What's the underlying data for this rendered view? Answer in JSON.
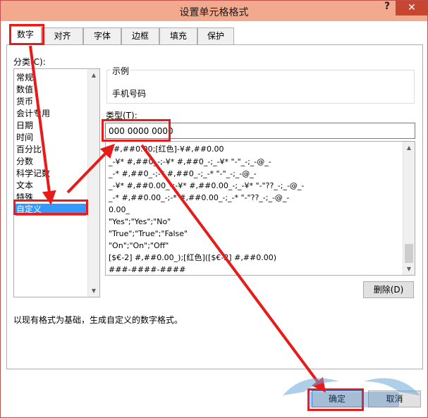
{
  "window": {
    "title": "设置单元格格式",
    "help": "?",
    "close": "✕"
  },
  "tabs": [
    "数字",
    "对齐",
    "字体",
    "边框",
    "填充",
    "保护"
  ],
  "category": {
    "label": "分类(C):",
    "items": [
      "常规",
      "数值",
      "货币",
      "会计专用",
      "日期",
      "时间",
      "百分比",
      "分数",
      "科学记数",
      "文本",
      "特殊",
      "自定义"
    ],
    "selected": "自定义"
  },
  "sample": {
    "label": "示例",
    "value": "手机号码"
  },
  "type": {
    "label": "类型(T):",
    "value": "000 0000 0000",
    "formats": [
      "¥#,##0.00;[红色]-¥#,##0.00",
      "_-¥* #,##0_-;-¥* #,##0_-;_-¥* \"-\"_-;_-@_-",
      "_-* #,##0_-;-* #,##0_-;_-* \"-\"_-;_-@_-",
      "_-¥* #,##0.00_-;-¥* #,##0.00_-;_-¥* \"-\"??_-;_-@_-",
      "_-* #,##0.00_-;-* #,##0.00_-;_-* \"-\"??_-;_-@_-",
      "0.00_",
      "\"Yes\";\"Yes\";\"No\"",
      "\"True\";\"True\";\"False\"",
      "\"On\";\"On\";\"Off\"",
      "[$€-2] #,##0.00_);[红色]([$€-2] #,##0.00)",
      "###-####-####"
    ]
  },
  "buttons": {
    "delete": "删除(D)",
    "ok": "确定",
    "cancel": "取消"
  },
  "description": "以现有格式为基础，生成自定义的数字格式。",
  "scroll": {
    "up": "▲",
    "down": "▼"
  },
  "colors": {
    "annotation": "#e81a1a",
    "titlebar": "#f3a98e",
    "close": "#c74630",
    "selection": "#3399ff"
  }
}
